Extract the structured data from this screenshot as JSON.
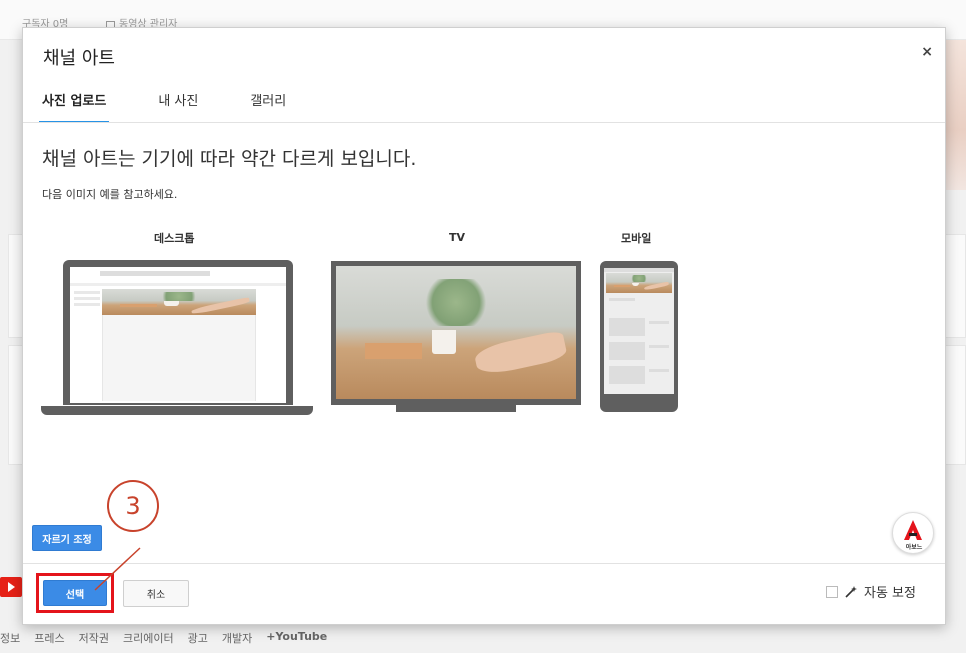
{
  "background": {
    "top_items": [
      "구독자 0명",
      "동영상 관리자"
    ],
    "footer_links": [
      "정보",
      "프레스",
      "저작권",
      "크리에이터",
      "광고",
      "개발자",
      "+YouTube"
    ]
  },
  "dialog": {
    "title": "채널 아트",
    "close_label": "×",
    "tabs": [
      {
        "label": "사진 업로드",
        "active": true
      },
      {
        "label": "내 사진",
        "active": false
      },
      {
        "label": "갤러리",
        "active": false
      }
    ],
    "heading": "채널 아트는 기기에 따라 약간 다르게 보입니다.",
    "subtext": "다음 이미지 예를 참고하세요.",
    "devices": {
      "desktop": "데스크톱",
      "tv": "TV",
      "mobile": "모바일"
    },
    "crop_button": "자르기 조정",
    "select_button": "선택",
    "cancel_button": "취소",
    "auto_correct_label": "자동 보정",
    "auto_correct_checked": false,
    "logo_text": "아보느"
  },
  "annotation": {
    "step": "3"
  },
  "colors": {
    "accent": "#3b8be6",
    "highlight": "#e4141b",
    "annotation": "#c8432c"
  }
}
